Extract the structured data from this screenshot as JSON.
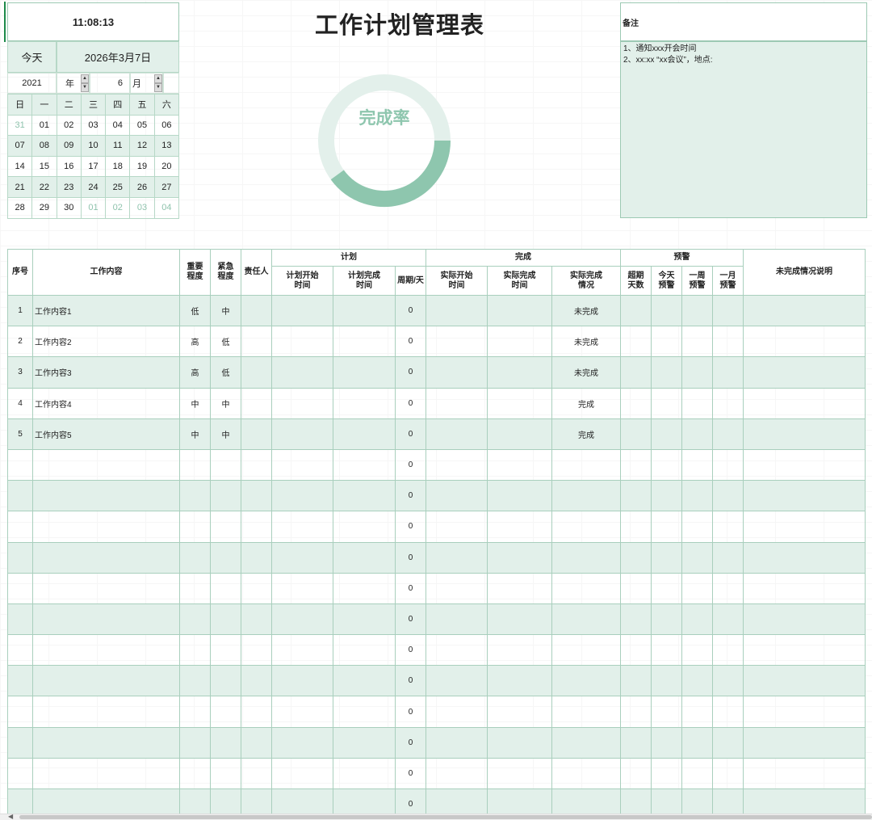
{
  "clock": "11:08:13",
  "today_label": "今天",
  "today_date": "2026年3月7日",
  "year_value": "2021",
  "year_label": "年",
  "month_value": "6",
  "month_label": "月",
  "weekdays": [
    "日",
    "一",
    "二",
    "三",
    "四",
    "五",
    "六"
  ],
  "calendar_weeks": [
    [
      "31",
      "01",
      "02",
      "03",
      "04",
      "05",
      "06"
    ],
    [
      "07",
      "08",
      "09",
      "10",
      "11",
      "12",
      "13"
    ],
    [
      "14",
      "15",
      "16",
      "17",
      "18",
      "19",
      "20"
    ],
    [
      "21",
      "22",
      "23",
      "24",
      "25",
      "26",
      "27"
    ],
    [
      "28",
      "29",
      "30",
      "01",
      "02",
      "03",
      "04"
    ]
  ],
  "title": "工作计划管理表",
  "donut_label": "完成率",
  "donut_fraction": 0.4,
  "notes": {
    "heading": "备注",
    "line1": "1、通知xxx开会时间",
    "line2": "2、xx:xx “xx会议”，地点:"
  },
  "table": {
    "headers": {
      "index": "序号",
      "content": "工作内容",
      "importance": "重要程度",
      "urgency": "紧急程度",
      "owner": "责任人",
      "plan": "计划",
      "plan_start": "计划开始时间",
      "plan_end": "计划完成时间",
      "cycle": "周期/天",
      "done": "完成",
      "actual_start": "实际开始时间",
      "actual_end": "实际完成时间",
      "actual_status": "实际完成情况",
      "warning": "预警",
      "overdue_days": "超期天数",
      "today_warn": "今天预警",
      "week_warn": "一周预警",
      "month_warn": "一月预警",
      "incomplete_note": "未完成情况说明"
    },
    "rows": [
      {
        "index": "1",
        "content": "工作内容1",
        "importance": "低",
        "urgency": "中",
        "cycle": "0",
        "status": "未完成"
      },
      {
        "index": "2",
        "content": "工作内容2",
        "importance": "高",
        "urgency": "低",
        "cycle": "0",
        "status": "未完成"
      },
      {
        "index": "3",
        "content": "工作内容3",
        "importance": "高",
        "urgency": "低",
        "cycle": "0",
        "status": "未完成"
      },
      {
        "index": "4",
        "content": "工作内容4",
        "importance": "中",
        "urgency": "中",
        "cycle": "0",
        "status": "完成"
      },
      {
        "index": "5",
        "content": "工作内容5",
        "importance": "中",
        "urgency": "中",
        "cycle": "0",
        "status": "完成"
      },
      {
        "index": "",
        "content": "",
        "importance": "",
        "urgency": "",
        "cycle": "0",
        "status": ""
      },
      {
        "index": "",
        "content": "",
        "importance": "",
        "urgency": "",
        "cycle": "0",
        "status": ""
      },
      {
        "index": "",
        "content": "",
        "importance": "",
        "urgency": "",
        "cycle": "0",
        "status": ""
      },
      {
        "index": "",
        "content": "",
        "importance": "",
        "urgency": "",
        "cycle": "0",
        "status": ""
      },
      {
        "index": "",
        "content": "",
        "importance": "",
        "urgency": "",
        "cycle": "0",
        "status": ""
      },
      {
        "index": "",
        "content": "",
        "importance": "",
        "urgency": "",
        "cycle": "0",
        "status": ""
      },
      {
        "index": "",
        "content": "",
        "importance": "",
        "urgency": "",
        "cycle": "0",
        "status": ""
      },
      {
        "index": "",
        "content": "",
        "importance": "",
        "urgency": "",
        "cycle": "0",
        "status": ""
      },
      {
        "index": "",
        "content": "",
        "importance": "",
        "urgency": "",
        "cycle": "0",
        "status": ""
      },
      {
        "index": "",
        "content": "",
        "importance": "",
        "urgency": "",
        "cycle": "0",
        "status": ""
      },
      {
        "index": "",
        "content": "",
        "importance": "",
        "urgency": "",
        "cycle": "0",
        "status": ""
      },
      {
        "index": "",
        "content": "",
        "importance": "",
        "urgency": "",
        "cycle": "0",
        "status": ""
      }
    ]
  },
  "colors": {
    "accent": "#8ec6ae",
    "shade": "#e2f0ea",
    "border": "#a9cfbd",
    "donut_track": "#e3f0eb",
    "donut_fill": "#8ec6ae"
  }
}
